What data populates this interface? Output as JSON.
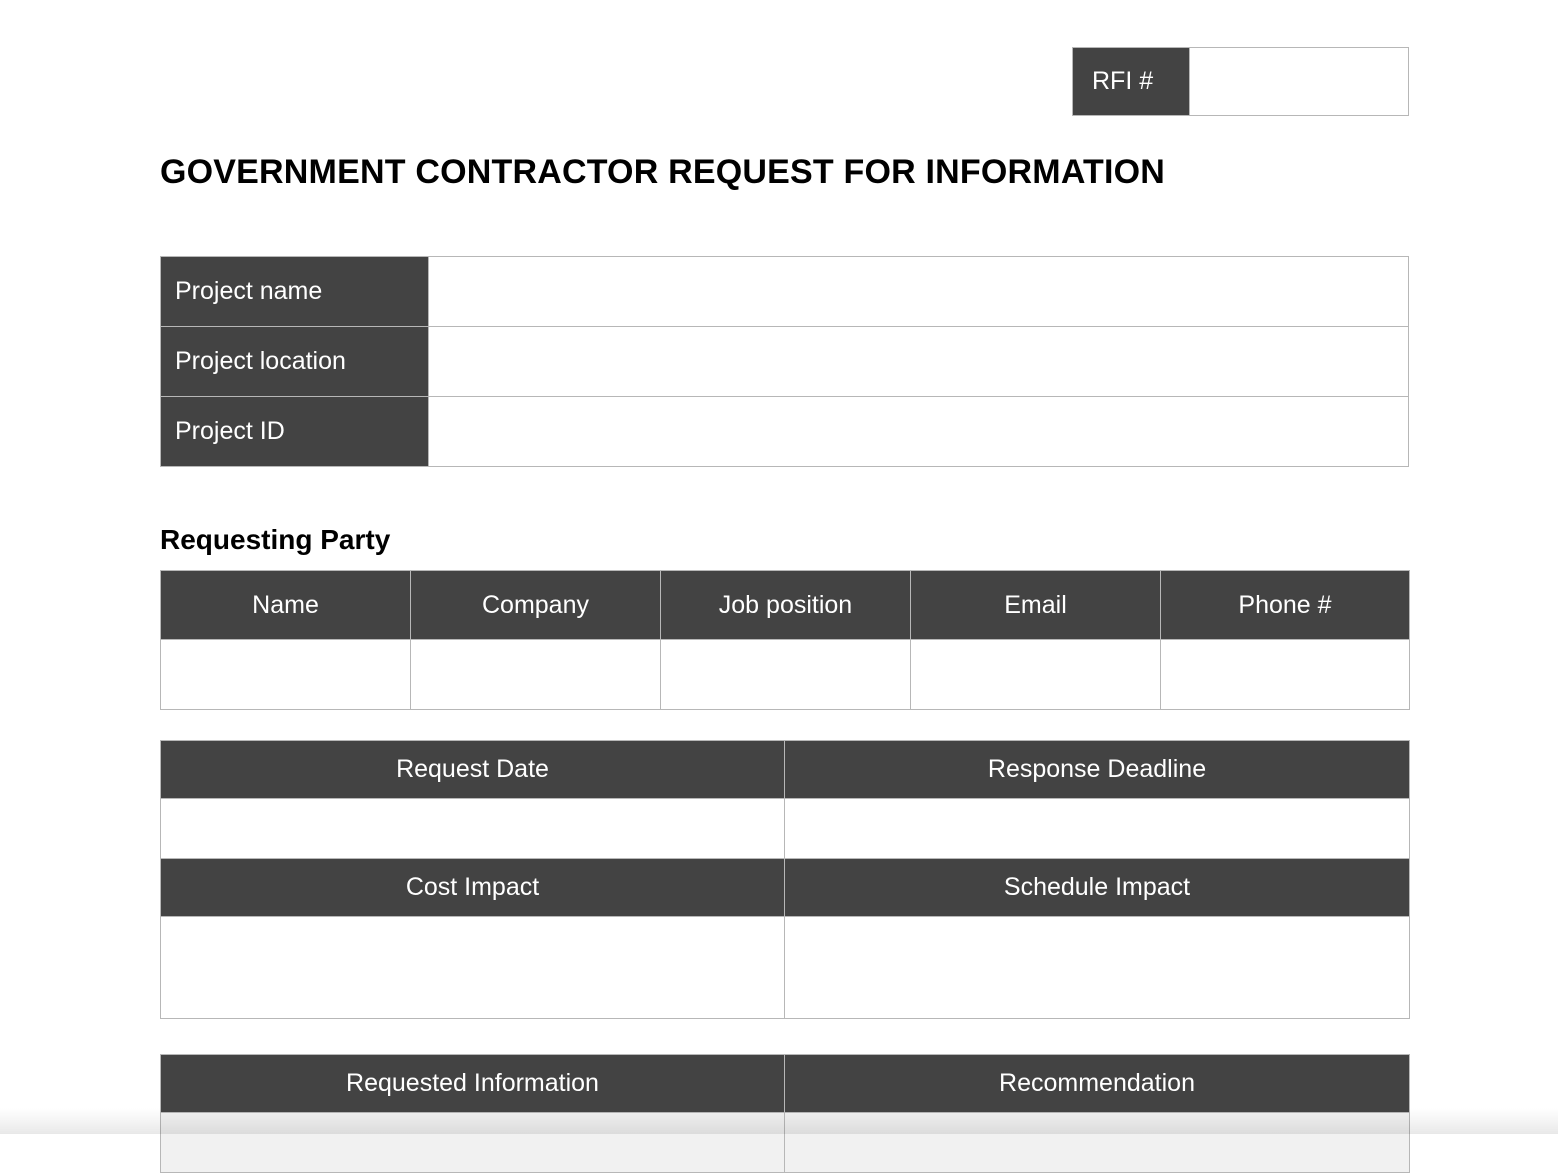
{
  "document": {
    "title": "GOVERNMENT CONTRACTOR REQUEST FOR INFORMATION"
  },
  "rfi": {
    "label": "RFI #",
    "value": "",
    "placeholder": ""
  },
  "project_info": {
    "rows": [
      {
        "label": "Project name",
        "value": ""
      },
      {
        "label": "Project location",
        "value": ""
      },
      {
        "label": "Project ID",
        "value": ""
      }
    ]
  },
  "requesting_party": {
    "heading": "Requesting Party",
    "columns": [
      "Name",
      "Company",
      "Job position",
      "Email",
      "Phone #"
    ],
    "rows": [
      {
        "name": "",
        "company": "",
        "job_position": "",
        "email": "",
        "phone": ""
      }
    ]
  },
  "dates_impact": {
    "date_headers": [
      "Request Date",
      "Response Deadline"
    ],
    "date_values": [
      "",
      ""
    ],
    "impact_headers": [
      "Cost Impact",
      "Schedule Impact"
    ],
    "impact_values": [
      "",
      ""
    ]
  },
  "info_recommendation": {
    "headers": [
      "Requested Information",
      "Recommendation"
    ],
    "values": [
      "",
      ""
    ]
  },
  "theme": {
    "header_fill": "#434343",
    "header_text": "#ffffff",
    "border": "#b7b7b7",
    "page_background": "#ffffff",
    "body_text": "#000000"
  }
}
